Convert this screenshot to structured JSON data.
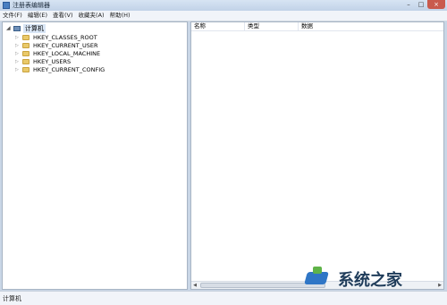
{
  "window": {
    "title": "注册表编辑器",
    "controls": {
      "minimize": "–",
      "maximize": "□",
      "close": "×"
    }
  },
  "menu": [
    "文件(F)",
    "编辑(E)",
    "查看(V)",
    "收藏夹(A)",
    "帮助(H)"
  ],
  "tree": {
    "root": {
      "label": "计算机",
      "expander": "◢",
      "icon": "computer-icon"
    },
    "items": [
      {
        "label": "HKEY_CLASSES_ROOT",
        "expander": "▷",
        "icon": "folder-icon"
      },
      {
        "label": "HKEY_CURRENT_USER",
        "expander": "▷",
        "icon": "folder-icon"
      },
      {
        "label": "HKEY_LOCAL_MACHINE",
        "expander": "▷",
        "icon": "folder-icon"
      },
      {
        "label": "HKEY_USERS",
        "expander": "▷",
        "icon": "folder-icon"
      },
      {
        "label": "HKEY_CURRENT_CONFIG",
        "expander": "▷",
        "icon": "folder-icon"
      }
    ]
  },
  "list": {
    "columns": [
      "名称",
      "类型",
      "数据"
    ]
  },
  "scrollbar": {
    "left": "◀",
    "right": "▶"
  },
  "status": "计算机",
  "watermark": {
    "text": "系统之家"
  }
}
